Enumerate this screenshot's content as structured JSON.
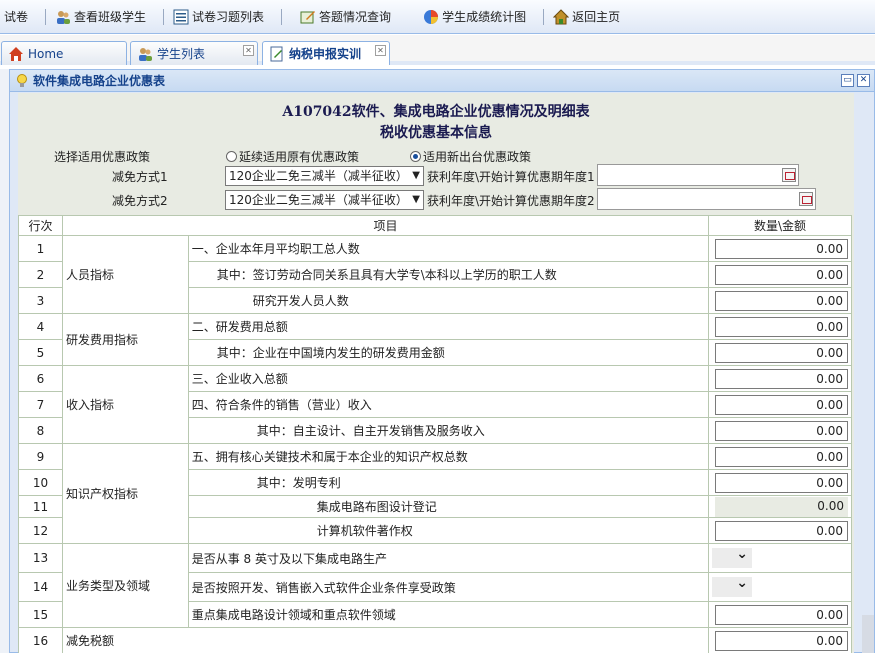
{
  "toolbar": {
    "items": [
      "试卷",
      "查看班级学生",
      "试卷习题列表",
      "答题情况查询",
      "学生成绩统计图",
      "返回主页"
    ]
  },
  "tabs": [
    {
      "label": "Home"
    },
    {
      "label": "学生列表"
    },
    {
      "label": "纳税申报实训"
    }
  ],
  "panel": {
    "title": "软件集成电路企业优惠表"
  },
  "form": {
    "title1": "A107042软件、集成电路企业优惠情况及明细表",
    "title2": "税收优惠基本信息",
    "policy_label": "选择适用优惠政策",
    "policy_options": [
      {
        "label": "延续适用原有优惠政策",
        "checked": false
      },
      {
        "label": "适用新出台优惠政策",
        "checked": true
      }
    ],
    "method1_label": "减免方式1",
    "method1_value": "120企业二免三减半（减半征收）",
    "year1_label": "获利年度\\开始计算优惠期年度1",
    "method2_label": "减免方式2",
    "method2_value": "120企业二免三减半（减半征收）",
    "year2_label": "获利年度\\开始计算优惠期年度2"
  },
  "table": {
    "headers": [
      "行次",
      "项目",
      "数量\\金额"
    ],
    "rows": [
      {
        "no": "1",
        "cat": "人员指标",
        "item": "一、企业本年月平均职工总人数",
        "val": "0.00"
      },
      {
        "no": "2",
        "item": "其中：签订劳动合同关系且具有大学专\\本科以上学历的职工人数",
        "val": "0.00"
      },
      {
        "no": "3",
        "item": "研究开发人员人数",
        "val": "0.00"
      },
      {
        "no": "4",
        "cat": "研发费用指标",
        "item": "二、研发费用总额",
        "val": "0.00"
      },
      {
        "no": "5",
        "item": "其中：企业在中国境内发生的研发费用金额",
        "val": "0.00"
      },
      {
        "no": "6",
        "cat": "收入指标",
        "item": "三、企业收入总额",
        "val": "0.00"
      },
      {
        "no": "7",
        "item": "四、符合条件的销售（营业）收入",
        "val": "0.00"
      },
      {
        "no": "8",
        "item": "其中：自主设计、自主开发销售及服务收入",
        "val": "0.00"
      },
      {
        "no": "9",
        "cat": "知识产权指标",
        "item": "五、拥有核心关键技术和属于本企业的知识产权总数",
        "val": "0.00"
      },
      {
        "no": "10",
        "item": "其中：发明专利",
        "val": "0.00"
      },
      {
        "no": "11",
        "item": "集成电路布图设计登记",
        "val": "0.00"
      },
      {
        "no": "12",
        "item": "计算机软件著作权",
        "val": "0.00"
      },
      {
        "no": "13",
        "cat": "业务类型及领域",
        "item": "是否从事 8 英寸及以下集成电路生产",
        "val": ""
      },
      {
        "no": "14",
        "item": "是否按照开发、销售嵌入式软件企业条件享受政策",
        "val": ""
      },
      {
        "no": "15",
        "item": "重点集成电路设计领域和重点软件领域",
        "val": "0.00"
      },
      {
        "no": "16",
        "cat": "减免税额",
        "item": "",
        "val": "0.00"
      }
    ]
  }
}
